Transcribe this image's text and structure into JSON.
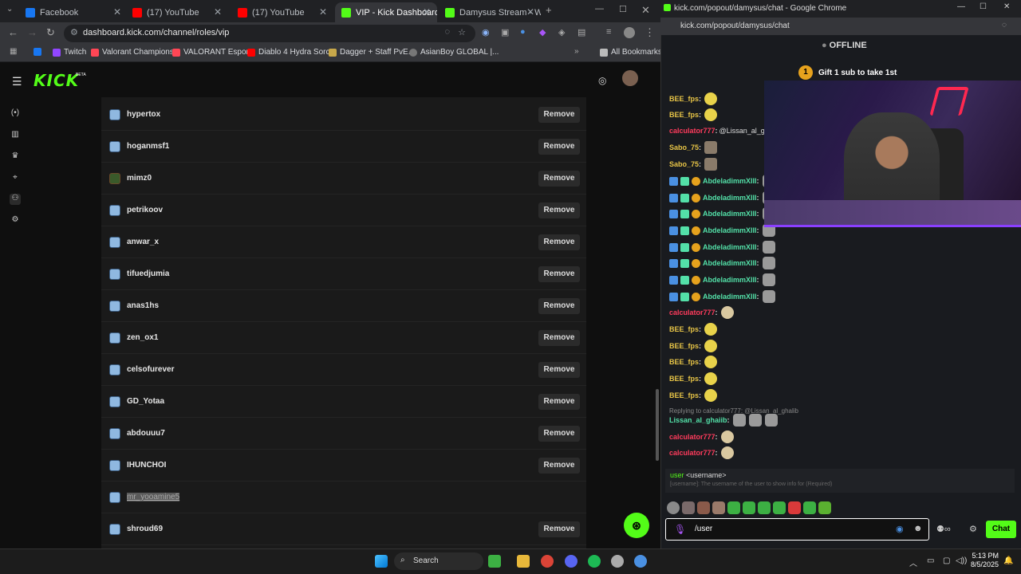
{
  "browser": {
    "tabs": [
      {
        "label": "Facebook",
        "favicon": "facebook-icon",
        "color": "#1877f2"
      },
      {
        "label": "(17) YouTube",
        "favicon": "youtube-icon",
        "color": "#ff0000"
      },
      {
        "label": "(17) YouTube",
        "favicon": "youtube-icon",
        "color": "#ff0000"
      },
      {
        "label": "VIP - Kick Dashboard",
        "favicon": "kick-icon",
        "color": "#53fc18"
      },
      {
        "label": "Damysus Stream - Wat",
        "favicon": "kick-icon",
        "color": "#53fc18"
      }
    ],
    "url": "dashboard.kick.com/channel/roles/vip",
    "bookmarks": [
      "Twitch",
      "Valorant Champions...",
      "VALORANT Esports",
      "Diablo 4 Hydra Sorc...",
      "Dagger + Staff PvE...",
      "AsianBoy GLOBAL |..."
    ],
    "all_bookmarks": "All Bookmarks"
  },
  "kick": {
    "logo": "KICK",
    "beta": "BETA",
    "remove_label": "Remove",
    "vips": [
      "hypertox",
      "hoganmsf1",
      "mimz0",
      "petrikoov",
      "anwar_x",
      "tifuedjumia",
      "anas1hs",
      "zen_ox1",
      "celsofurever",
      "GD_Yotaa",
      "abdouuu7",
      "IHUNCHOI",
      "mr_yooamine5",
      "shroud69"
    ]
  },
  "popout": {
    "title": "kick.com/popout/damysus/chat - Google Chrome",
    "url": "kick.com/popout/damysus/chat",
    "status": "OFFLINE",
    "gift_count": "1",
    "gift_text": "Gift 1 sub to take 1st",
    "messages": [
      {
        "user": "BEE_fps",
        "color": "#e8c547",
        "text": ""
      },
      {
        "user": "BEE_fps",
        "color": "#e8c547",
        "text": ""
      },
      {
        "user": "calculator777",
        "color": "#ff3b5c",
        "text": "@Lissan_al_gl"
      },
      {
        "user": "Sabo_75",
        "color": "#e8c547",
        "text": ""
      },
      {
        "user": "Sabo_75",
        "color": "#e8c547",
        "text": ""
      },
      {
        "user": "AbdeladimmXIII",
        "color": "#53e0a8",
        "text": ""
      },
      {
        "user": "AbdeladimmXIII",
        "color": "#53e0a8",
        "text": ""
      },
      {
        "user": "AbdeladimmXIII",
        "color": "#53e0a8",
        "text": ""
      },
      {
        "user": "AbdeladimmXIII",
        "color": "#53e0a8",
        "text": ""
      },
      {
        "user": "AbdeladimmXIII",
        "color": "#53e0a8",
        "text": ""
      },
      {
        "user": "AbdeladimmXIII",
        "color": "#53e0a8",
        "text": ""
      },
      {
        "user": "AbdeladimmXIII",
        "color": "#53e0a8",
        "text": ""
      },
      {
        "user": "AbdeladimmXIII",
        "color": "#53e0a8",
        "text": ""
      },
      {
        "user": "calculator777",
        "color": "#ff3b5c",
        "text": ""
      },
      {
        "user": "BEE_fps",
        "color": "#e8c547",
        "text": ""
      },
      {
        "user": "BEE_fps",
        "color": "#e8c547",
        "text": ""
      },
      {
        "user": "BEE_fps",
        "color": "#e8c547",
        "text": ""
      },
      {
        "user": "BEE_fps",
        "color": "#e8c547",
        "text": ""
      },
      {
        "user": "BEE_fps",
        "color": "#e8c547",
        "text": ""
      }
    ],
    "reply_text": "Replying to calculator777: @Lissan_al_ghalib",
    "reply_user": "Lissan_al_ghaiib",
    "after_reply": [
      {
        "user": "calculator777",
        "color": "#ff3b5c"
      },
      {
        "user": "calculator777",
        "color": "#ff3b5c"
      }
    ],
    "suggest_cmd": "user",
    "suggest_arg": "<username>",
    "suggest_desc": "[username]: The username of the user to show info for (Required)",
    "input_value": "/user",
    "chat_button": "Chat"
  },
  "taskbar": {
    "search": "Search",
    "time": "5:13 PM",
    "date": "8/5/2025"
  }
}
